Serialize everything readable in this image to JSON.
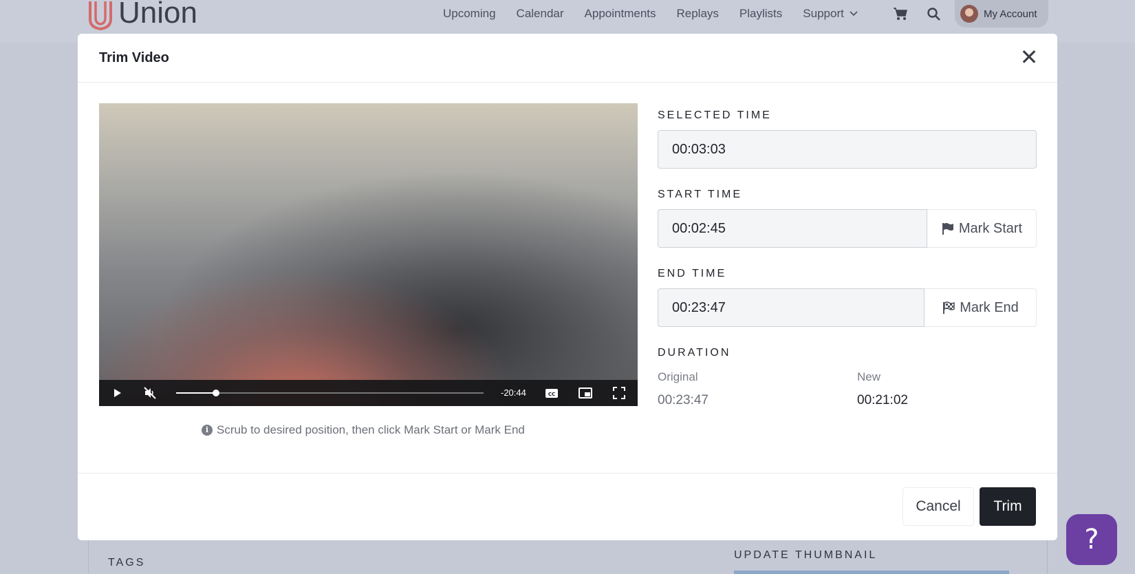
{
  "header": {
    "brand": "Union",
    "nav": [
      "Upcoming",
      "Calendar",
      "Appointments",
      "Replays",
      "Playlists",
      "Support"
    ],
    "account_label": "My Account",
    "icons": [
      "cart-icon",
      "search-icon"
    ]
  },
  "background": {
    "tags_label": "TAGS",
    "thumbnail_label": "UPDATE THUMBNAIL"
  },
  "modal": {
    "title": "Trim Video",
    "close_glyph": "✕",
    "player": {
      "time_remaining": "-20:44",
      "progress_fraction": 0.13
    },
    "hint": "Scrub to desired position, then click Mark Start or Mark End",
    "selected": {
      "label": "SELECTED TIME",
      "value": "00:03:03"
    },
    "start": {
      "label": "START TIME",
      "value": "00:02:45",
      "button": "Mark Start"
    },
    "end": {
      "label": "END TIME",
      "value": "00:23:47",
      "button": "Mark End"
    },
    "duration": {
      "label": "DURATION",
      "original_label": "Original",
      "original_value": "00:23:47",
      "new_label": "New",
      "new_value": "00:21:02"
    },
    "footer": {
      "cancel": "Cancel",
      "trim": "Trim"
    }
  },
  "help": {
    "glyph": "?"
  },
  "colors": {
    "accent_purple": "#6c3fa3",
    "primary_dark": "#1f2228",
    "brand_red": "#d9534f"
  }
}
